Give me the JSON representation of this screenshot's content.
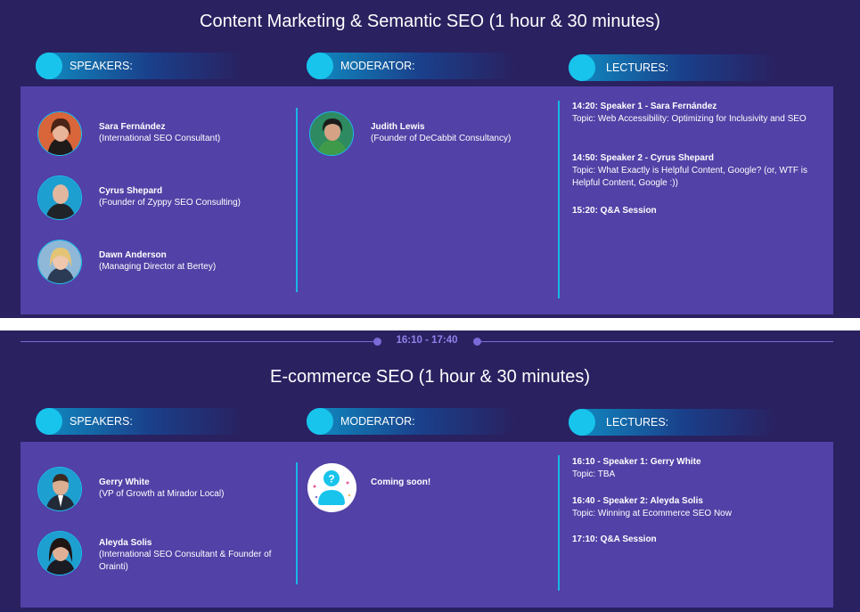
{
  "session1": {
    "title": "Content Marketing & Semantic SEO (1 hour & 30 minutes)",
    "speakers_label": "SPEAKERS:",
    "moderator_label": "MODERATOR:",
    "lectures_label": "LECTURES:",
    "speakers": [
      {
        "name": "Sara Fernández",
        "role": "(International SEO Consultant)"
      },
      {
        "name": "Cyrus Shepard",
        "role": "(Founder of Zyppy SEO Consulting)"
      },
      {
        "name": "Dawn Anderson",
        "role": "(Managing Director at Bertey)"
      }
    ],
    "moderator": {
      "name": "Judith Lewis",
      "role": "(Founder of DeCabbit Consultancy)"
    },
    "lectures": [
      {
        "title": "14:20: Speaker 1 - Sara Fernández",
        "topic": "Topic: Web Accessibility: Optimizing for Inclusivity and SEO"
      },
      {
        "title": "14:50: Speaker 2 - Cyrus Shepard",
        "topic": "Topic: What Exactly is Helpful Content, Google? (or, WTF is Helpful Content, Google :))"
      },
      {
        "title": "15:20: Q&A Session",
        "topic": ""
      }
    ]
  },
  "timebar": {
    "time": "16:10 - 17:40"
  },
  "session2": {
    "title": "E-commerce SEO (1 hour & 30 minutes)",
    "speakers_label": "SPEAKERS:",
    "moderator_label": "MODERATOR:",
    "lectures_label": "LECTURES:",
    "speakers": [
      {
        "name": "Gerry White",
        "role": "(VP of Growth at Mirador Local)"
      },
      {
        "name": "Aleyda Solis",
        "role": "(International SEO Consultant & Founder of Orainti)"
      }
    ],
    "moderator": {
      "name": "Coming soon!",
      "role": "",
      "icon": "question-avatar-icon"
    },
    "lectures": [
      {
        "title": "16:10 - Speaker 1: Gerry White",
        "topic": "Topic: TBA"
      },
      {
        "title": "16:40 - Speaker 2: Aleyda Solis",
        "topic": "Topic: Winning at Ecommerce SEO Now"
      },
      {
        "title": "17:10: Q&A Session",
        "topic": ""
      }
    ]
  },
  "colors": {
    "background": "#2a2160",
    "panel": "#5241a6",
    "accent": "#18c4ec",
    "time_accent": "#8f82ec"
  }
}
